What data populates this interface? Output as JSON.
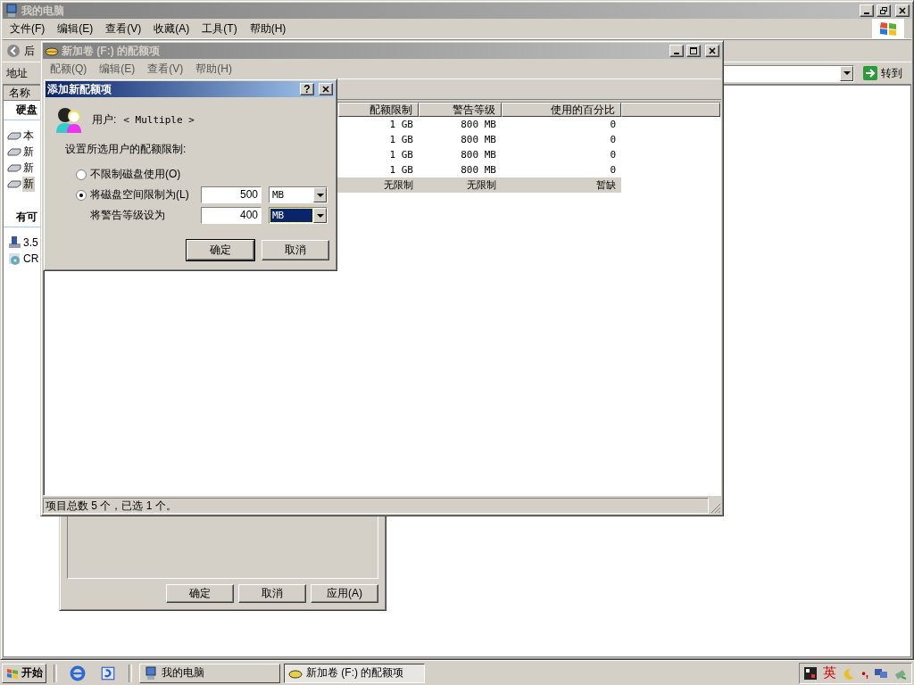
{
  "explorer": {
    "title": "我的电脑",
    "menu": [
      "文件(F)",
      "编辑(E)",
      "查看(V)",
      "收藏(A)",
      "工具(T)",
      "帮助(H)"
    ],
    "back_button": "后",
    "address_label": "地址",
    "go_button": "转到",
    "list_header": "名称",
    "groups": [
      {
        "title": "硬盘",
        "items": [
          {
            "label": "本",
            "kind": "drive",
            "selected": false
          },
          {
            "label": "新",
            "kind": "drive",
            "selected": false
          },
          {
            "label": "新",
            "kind": "drive",
            "selected": false
          },
          {
            "label": "新",
            "kind": "drive",
            "selected": true
          }
        ]
      },
      {
        "title": "有可",
        "items": [
          {
            "label": "3.5",
            "kind": "floppy",
            "selected": false
          },
          {
            "label": "CR",
            "kind": "cd",
            "selected": false
          }
        ]
      }
    ]
  },
  "properties_dialog": {
    "buttons": [
      "确定",
      "取消",
      "应用(A)"
    ]
  },
  "quota_window": {
    "title": "新加卷 (F:) 的配额项",
    "menu": [
      "配额(Q)",
      "编辑(E)",
      "查看(V)",
      "帮助(H)"
    ],
    "columns": [
      "配额限制",
      "警告等级",
      "使用的百分比"
    ],
    "rows": [
      {
        "cells": [
          "1 GB",
          "800 MB",
          "0"
        ],
        "selected": false
      },
      {
        "cells": [
          "1 GB",
          "800 MB",
          "0"
        ],
        "selected": false
      },
      {
        "cells": [
          "1 GB",
          "800 MB",
          "0"
        ],
        "selected": false
      },
      {
        "cells": [
          "1 GB",
          "800 MB",
          "0"
        ],
        "selected": false
      },
      {
        "cells": [
          "无限制",
          "无限制",
          "暂缺"
        ],
        "selected": true
      }
    ],
    "status_bar": "项目总数 5 个，已选 1 个。"
  },
  "add_quota_dialog": {
    "title": "添加新配额项",
    "help_button": "?",
    "user_label": "用户:",
    "user_value": "< Multiple >",
    "prompt": "设置所选用户的配额限制:",
    "options": [
      {
        "label": "不限制磁盘使用(O)",
        "selected": false
      },
      {
        "label": "将磁盘空间限制为(L)",
        "selected": true
      }
    ],
    "limit": {
      "value": "500",
      "unit": "MB",
      "unit_focused": false
    },
    "warning": {
      "label": "将警告等级设为",
      "value": "400",
      "unit": "MB",
      "unit_focused": true
    },
    "buttons": [
      "确定",
      "取消"
    ]
  },
  "taskbar": {
    "start": "开始",
    "tasks": [
      {
        "label": "我的电脑",
        "kind": "computer",
        "selected": false
      },
      {
        "label": "新加卷 (F:) 的配额项",
        "kind": "drive",
        "selected": true
      }
    ],
    "ime": "英",
    "punct": "•,"
  }
}
